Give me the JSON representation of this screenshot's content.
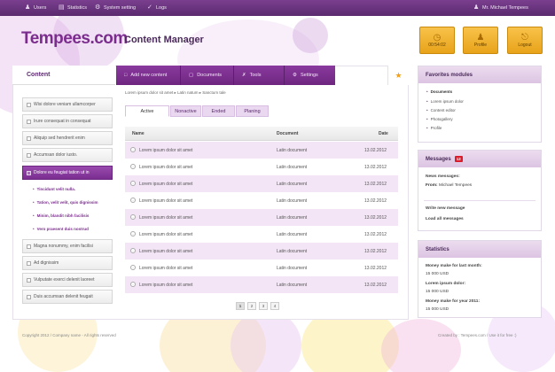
{
  "topbar": {
    "users": "Users",
    "statistics": "Statistics",
    "system_setting": "System setting",
    "logs": "Logs",
    "user_name": "Mr. Michael Tempees"
  },
  "brand": {
    "logo": "Tempees.com",
    "title": "Content Manager"
  },
  "top_buttons": {
    "time": "00:54:02",
    "profile": "Profile",
    "logout": "Logout"
  },
  "sidebar": {
    "title": "Content",
    "items": [
      "Wisi dolore veniam ullamcorper",
      "Irure consequat in consequat",
      "Aliquip sed hendrerit enim",
      "Accumsan dolor iusto.",
      "Dolore eu feugiat tation ut in"
    ],
    "subitems": [
      "Tincidunt velit nulla.",
      "Tation, velit velit, quis dignissim",
      "Minim, blandit nibh facilisis",
      "Vero praesent duis nostrud"
    ],
    "items_after": [
      "Magna nonummy, enim facilisi",
      "Ad dignissim",
      "Vulputate exerci delenit laoreet",
      "Duis accumsan delenit feugait"
    ]
  },
  "main_tabs": {
    "add_new": "Add new content",
    "documents": "Documents",
    "tools": "Tools",
    "settings": "Settings"
  },
  "breadcrumb": "Lorem ipsum dolor sit amet  ▸ Latin natum  ▸ Sanctum tale",
  "subtabs": [
    "Active",
    "Nonactive",
    "Ended",
    "Planing"
  ],
  "table": {
    "headers": {
      "name": "Name",
      "document": "Document",
      "date": "Date"
    },
    "rows": [
      {
        "name": "Lorem ipsum dolor sit amet",
        "document": "Latin document",
        "date": "13.02.2012"
      },
      {
        "name": "Lorem ipsum dolor sit amet",
        "document": "Latin document",
        "date": "13.02.2012"
      },
      {
        "name": "Lorem ipsum dolor sit amet",
        "document": "Latin document",
        "date": "13.02.2012"
      },
      {
        "name": "Lorem ipsum dolor sit amet",
        "document": "Latin document",
        "date": "13.02.2012"
      },
      {
        "name": "Lorem ipsum dolor sit amet",
        "document": "Latin document",
        "date": "13.02.2012"
      },
      {
        "name": "Lorem ipsum dolor sit amet",
        "document": "Latin document",
        "date": "13.02.2012"
      },
      {
        "name": "Lorem ipsum dolor sit amet",
        "document": "Latin document",
        "date": "13.02.2012"
      },
      {
        "name": "Lorem ipsum dolor sit amet",
        "document": "Latin document",
        "date": "13.02.2012"
      },
      {
        "name": "Lorem ipsum dolor sit amet",
        "document": "Latin document",
        "date": "13.02.2012"
      }
    ]
  },
  "pagination": [
    "1",
    "2",
    "3",
    "4"
  ],
  "favorites": {
    "title": "Favorites modules",
    "items": [
      "Documents",
      "Lorem ipsum dolor",
      "Content editor",
      "Photogallery",
      "Profile"
    ]
  },
  "messages": {
    "title": "Messages",
    "count": "12",
    "news_label": "News messages:",
    "from_label": "From:",
    "from_value": "Michael Tempees",
    "write": "Write new message",
    "load": "Load all messages"
  },
  "statistics": {
    "title": "Statistics",
    "l1": "Money make for last month:",
    "v1": "15 000 USD",
    "l2": "Lorem ipsum dolor:",
    "v2": "15 000 USD",
    "l3": "Money make for year 2011:",
    "v3": "15 000 USD"
  },
  "footer": {
    "left": "Copyright 2012 / Company name - All rights reserved",
    "right": "Created by : Tempees.com / Use it for free :)"
  }
}
